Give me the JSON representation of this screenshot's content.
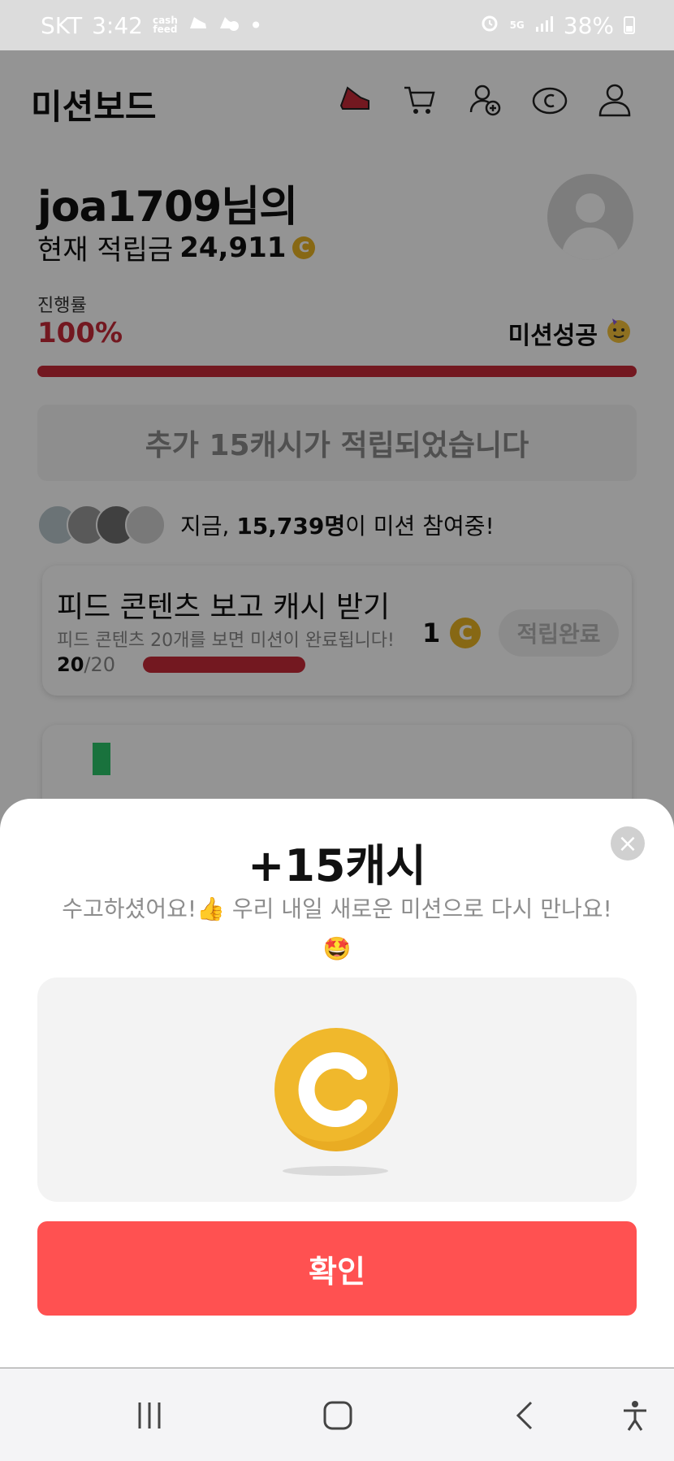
{
  "status_bar": {
    "carrier": "SKT",
    "time": "3:42",
    "notif_label": "cash\nfeed",
    "network": "5G",
    "battery": "38%"
  },
  "header": {
    "title": "미션보드",
    "icons": [
      "shoe-icon",
      "cart-icon",
      "add-user-icon",
      "coin-icon",
      "profile-icon"
    ]
  },
  "user": {
    "greeting": "joa1709님의",
    "points_label": "현재 적립금",
    "points_value": "24,911",
    "coin_symbol": "C"
  },
  "progress": {
    "label": "진행률",
    "value_text": "100%",
    "fraction": 1.0,
    "status": "미션성공"
  },
  "notice": "추가 15캐시가 적립되었습니다",
  "participants": {
    "prefix": "지금, ",
    "count": "15,739명",
    "suffix": "이 미션 참여중!"
  },
  "mission": {
    "title": "피드 콘텐츠 보고 캐시 받기",
    "description": "피드 콘텐츠 20개를 보면 미션이 완료됩니다!",
    "reward": "1",
    "button": "적립완료",
    "count_done": "20",
    "count_total": "/20"
  },
  "sheet": {
    "title": "+15캐시",
    "message": "수고하셨어요!👍 우리 내일 새로운 미션으로 다시 만나요!",
    "emoji": "🤩",
    "close": "×",
    "confirm": "확인"
  },
  "colors": {
    "accent_red": "#c62a37",
    "confirm": "#ff5151",
    "coin": "#f0b82c"
  }
}
